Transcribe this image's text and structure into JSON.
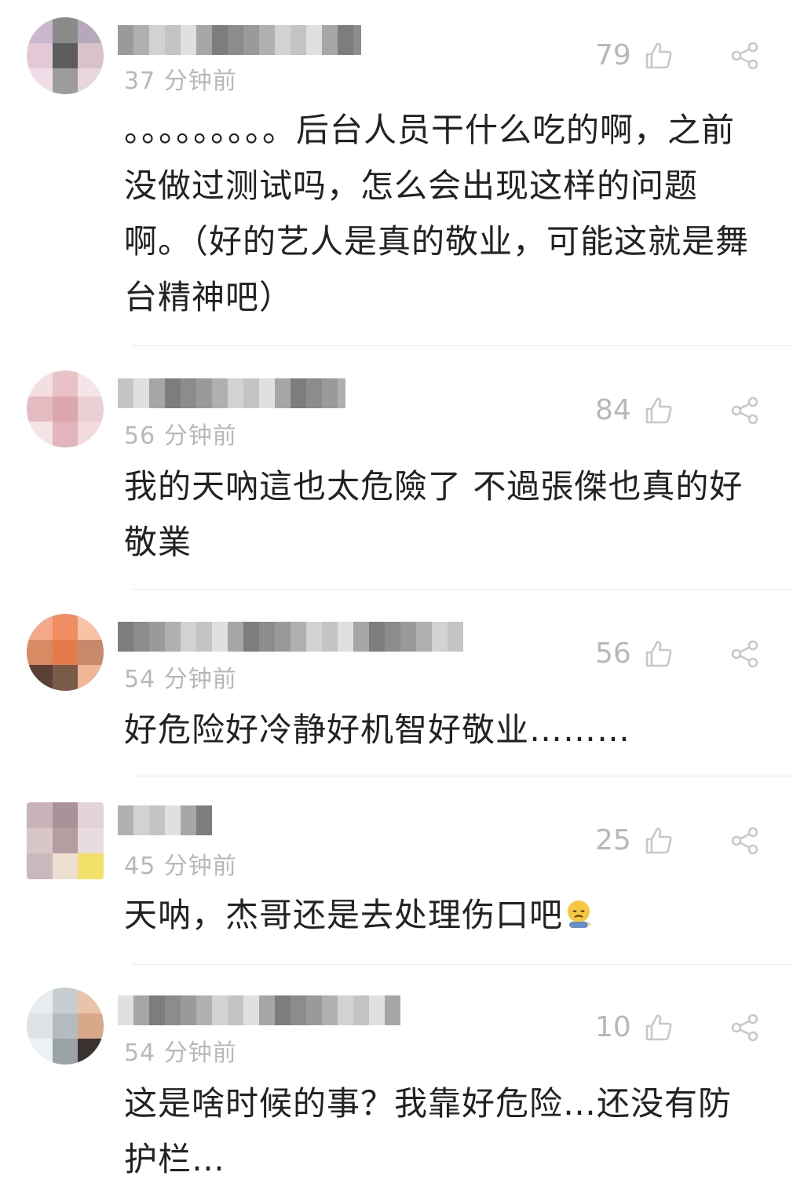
{
  "comments": [
    {
      "time": "37 分钟前",
      "likes": "79",
      "text": "。。。。。。。。。后台人员干什么吃的啊，之前没做过测试吗，怎么会出现这样的问题啊。（好的艺人是真的敬业，可能这就是舞台精神吧）",
      "avatar_colors": [
        "#c9b7cf",
        "#8a8a8a",
        "#b7a7bd",
        "#e3c9d8",
        "#5c5c5c",
        "#d8c2cc",
        "#f0dde7",
        "#9c9c9c",
        "#ead6df"
      ]
    },
    {
      "time": "56 分钟前",
      "likes": "84",
      "text": "我的天吶這也太危險了 不過張傑也真的好敬業",
      "avatar_colors": [
        "#f3dfe2",
        "#e9c2c8",
        "#f6e5e8",
        "#e6bcc3",
        "#dba6ae",
        "#eccfd4",
        "#f5e3e6",
        "#e2b5bc",
        "#f2dadd"
      ]
    },
    {
      "time": "54 分钟前",
      "likes": "56",
      "text": "好危险好冷静好机智好敬业………",
      "avatar_colors": [
        "#f3a987",
        "#ee8e62",
        "#f7c2a6",
        "#d98a62",
        "#e57a4a",
        "#c7896b",
        "#5a4036",
        "#7a5a48",
        "#f0b697"
      ]
    },
    {
      "time": "45 分钟前",
      "likes": "25",
      "text": "天呐，杰哥还是去处理伤口吧",
      "avatar_colors": [
        "#c7b3b8",
        "#a89398",
        "#e3d3d6",
        "#d8c6c9",
        "#b59da2",
        "#e8dcde",
        "#c9b9bc",
        "#ede0d2",
        "#f2e06a"
      ]
    },
    {
      "time": "54 分钟前",
      "likes": "10",
      "text": "这是啥时候的事？我靠好危险…还没有防护栏…",
      "avatar_colors": [
        "#e8ecef",
        "#c7ced3",
        "#e9c4a8",
        "#dde3e7",
        "#b5bcc0",
        "#d9a88a",
        "#eef1f3",
        "#9aa3a8",
        "#3a3230"
      ]
    }
  ]
}
